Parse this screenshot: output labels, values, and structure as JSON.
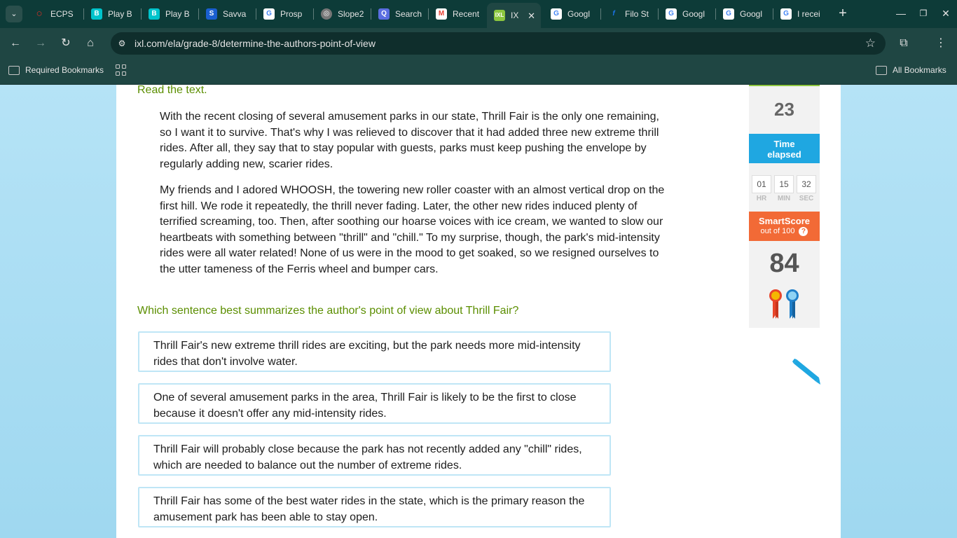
{
  "browser": {
    "tabs": [
      {
        "label": "ECPS",
        "fav_color": "#d93025",
        "fav_char": "○"
      },
      {
        "label": "Play B",
        "fav_color": "#00c4cc",
        "fav_char": "B"
      },
      {
        "label": "Play B",
        "fav_color": "#00c4cc",
        "fav_char": "B"
      },
      {
        "label": "Savva",
        "fav_color": "#1a5fd0",
        "fav_char": "S"
      },
      {
        "label": "Prosp",
        "fav_color": "#4285f4",
        "fav_char": "G"
      },
      {
        "label": "Slope2",
        "fav_color": "#777777",
        "fav_char": "◎"
      },
      {
        "label": "Search",
        "fav_color": "#5b6ee1",
        "fav_char": "Q"
      },
      {
        "label": "Recent",
        "fav_color": "#ea4335",
        "fav_char": "M"
      },
      {
        "label": "IX",
        "fav_color": "#8cc63f",
        "fav_char": "IXL"
      },
      {
        "label": "Googl",
        "fav_color": "#4285f4",
        "fav_char": "G"
      },
      {
        "label": "Filo St",
        "fav_color": "#1a73e8",
        "fav_char": "f"
      },
      {
        "label": "Googl",
        "fav_color": "#4285f4",
        "fav_char": "G"
      },
      {
        "label": "Googl",
        "fav_color": "#4285f4",
        "fav_char": "G"
      },
      {
        "label": "I recei",
        "fav_color": "#4285f4",
        "fav_char": "G"
      }
    ],
    "tab_close": "✕",
    "new_tab": "+",
    "url": "ixl.com/ela/grade-8/determine-the-authors-point-of-view",
    "bookmarks": {
      "required": "Required Bookmarks",
      "all": "All Bookmarks"
    }
  },
  "ixl": {
    "read_label": "Read the text.",
    "passage": [
      "With the recent closing of several amusement parks in our state, Thrill Fair is the only one remaining, so I want it to survive. That's why I was relieved to discover that it had added three new extreme thrill rides. After all, they say that to stay popular with guests, parks must keep pushing the envelope by regularly adding new, scarier rides.",
      "My friends and I adored WHOOSH, the towering new roller coaster with an almost vertical drop on the first hill. We rode it repeatedly, the thrill never fading. Later, the other new rides induced plenty of terrified screaming, too. Then, after soothing our hoarse voices with ice cream, we wanted to slow our heartbeats with something between \"thrill\" and \"chill.\" To my surprise, though, the park's mid-intensity rides were all water related! None of us were in the mood to get soaked, so we resigned ourselves to the utter tameness of the Ferris wheel and bumper cars."
    ],
    "question": "Which sentence best summarizes the author's point of view about Thrill Fair?",
    "choices": [
      "Thrill Fair's new extreme thrill rides are exciting, but the park needs more mid-intensity rides that don't involve water.",
      "One of several amusement parks in the area, Thrill Fair is likely to be the first to close because it doesn't offer any mid-intensity rides.",
      "Thrill Fair will probably close because the park has not recently added any \"chill\" rides, which are needed to balance out the number of extreme rides.",
      "Thrill Fair has some of the best water rides in the state, which is the primary reason the amusement park has been able to stay open."
    ],
    "sidebar": {
      "questions_answered": "23",
      "time_label": "Time elapsed",
      "timer": {
        "hr": "01",
        "min": "15",
        "sec": "32"
      },
      "timer_labels": {
        "hr": "HR",
        "min": "MIN",
        "sec": "SEC"
      },
      "smartscore_title": "SmartScore",
      "smartscore_sub": "out of 100",
      "help": "?",
      "smartscore": "84"
    }
  },
  "colors": {
    "ixl_green": "#5b8e00",
    "ixl_blue": "#1fa7e1",
    "ixl_orange": "#f26a36",
    "chrome_frame": "#1f4643"
  }
}
